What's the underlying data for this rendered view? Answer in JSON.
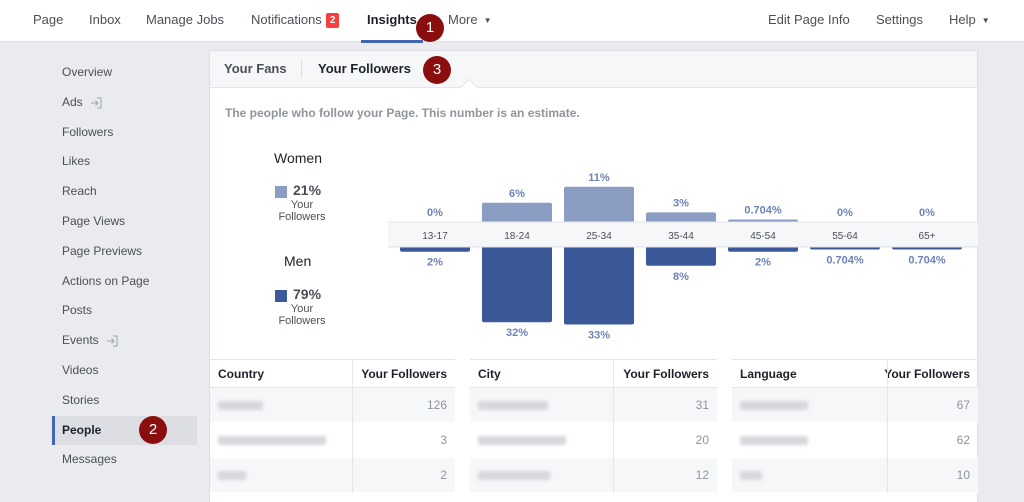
{
  "topnav": {
    "left": [
      {
        "id": "page",
        "label": "Page"
      },
      {
        "id": "inbox",
        "label": "Inbox"
      },
      {
        "id": "manage-jobs",
        "label": "Manage Jobs"
      },
      {
        "id": "notifications",
        "label": "Notifications",
        "badge": "2"
      },
      {
        "id": "insights",
        "label": "Insights",
        "active": true
      },
      {
        "id": "more",
        "label": "More"
      }
    ],
    "right": [
      {
        "id": "edit-page-info",
        "label": "Edit Page Info"
      },
      {
        "id": "settings",
        "label": "Settings"
      },
      {
        "id": "help",
        "label": "Help"
      }
    ]
  },
  "steps": [
    "1",
    "2",
    "3"
  ],
  "sidebar": {
    "items": [
      {
        "label": "Overview"
      },
      {
        "label": "Ads",
        "external": true
      },
      {
        "label": "Followers"
      },
      {
        "label": "Likes"
      },
      {
        "label": "Reach"
      },
      {
        "label": "Page Views"
      },
      {
        "label": "Page Previews"
      },
      {
        "label": "Actions on Page"
      },
      {
        "label": "Posts"
      },
      {
        "label": "Events",
        "external": true
      },
      {
        "label": "Videos"
      },
      {
        "label": "Stories"
      },
      {
        "label": "People",
        "active": true
      },
      {
        "label": "Messages"
      }
    ]
  },
  "tabs": [
    {
      "label": "Your Fans"
    },
    {
      "label": "Your Followers",
      "active": true
    }
  ],
  "description": "The people who follow your Page. This number is an estimate.",
  "legend": {
    "women": {
      "title": "Women",
      "pct": "21%",
      "sub1": "Your",
      "sub2": "Followers",
      "color": "#8b9dc3"
    },
    "men": {
      "title": "Men",
      "pct": "79%",
      "sub1": "Your",
      "sub2": "Followers",
      "color": "#3b5998"
    }
  },
  "chart_data": {
    "type": "bar",
    "title": "",
    "categories": [
      "13-17",
      "18-24",
      "25-34",
      "35-44",
      "45-54",
      "55-64",
      "65+"
    ],
    "series": [
      {
        "name": "Women",
        "color": "#8b9dc3",
        "values": [
          0,
          6,
          11,
          3,
          0.704,
          0,
          0
        ],
        "labels": [
          "0%",
          "6%",
          "11%",
          "3%",
          "0.704%",
          "0%",
          "0%"
        ]
      },
      {
        "name": "Men",
        "color": "#3b5998",
        "values": [
          2,
          32,
          33,
          8,
          2,
          0.704,
          0.704
        ],
        "labels": [
          "2%",
          "32%",
          "33%",
          "8%",
          "2%",
          "0.704%",
          "0.704%"
        ]
      }
    ],
    "xlabel": "",
    "ylabel": "",
    "legend": "left"
  },
  "tables": [
    {
      "col1": "Country",
      "col2": "Your Followers",
      "rows": [
        {
          "value": "126"
        },
        {
          "value": "3"
        },
        {
          "value": "2"
        }
      ]
    },
    {
      "col1": "City",
      "col2": "Your Followers",
      "rows": [
        {
          "value": "31"
        },
        {
          "value": "20"
        },
        {
          "value": "12"
        }
      ]
    },
    {
      "col1": "Language",
      "col2": "Your Followers",
      "rows": [
        {
          "value": "67"
        },
        {
          "value": "62"
        },
        {
          "value": "10"
        }
      ]
    }
  ]
}
